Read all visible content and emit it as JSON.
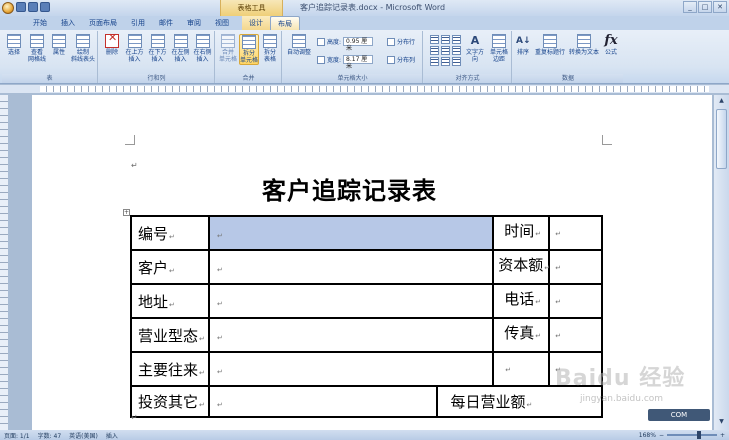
{
  "window": {
    "title": "客户追踪记录表.docx - Microsoft Word",
    "context_tools": "表格工具",
    "controls": [
      "_",
      "□",
      "✕"
    ]
  },
  "tabs": [
    {
      "label": "开始",
      "active": false
    },
    {
      "label": "插入",
      "active": false
    },
    {
      "label": "页面布局",
      "active": false
    },
    {
      "label": "引用",
      "active": false
    },
    {
      "label": "邮件",
      "active": false
    },
    {
      "label": "审阅",
      "active": false
    },
    {
      "label": "视图",
      "active": false
    },
    {
      "label": "设计",
      "active": false,
      "contextual": true
    },
    {
      "label": "布局",
      "active": true,
      "contextual": true
    }
  ],
  "ribbon": {
    "groups": {
      "table": "表",
      "rows_cols": "行和列",
      "merge": "合并",
      "cell_size": "单元格大小",
      "alignment": "对齐方式",
      "data": "数据"
    },
    "buttons": {
      "select": "选择",
      "view_gridlines": "查看\n网格线",
      "properties": "属性",
      "draw_diagonal": "绘制\n斜线表头",
      "delete": "删除",
      "insert_above": "在上方\n插入",
      "insert_below": "在下方\n插入",
      "insert_left": "在左侧\n插入",
      "insert_right": "在右侧\n插入",
      "merge_cells": "合并\n单元格",
      "split_cells": "拆分\n单元格",
      "split_table": "拆分\n表格",
      "autofit": "自动调整",
      "height_label": "高度:",
      "height_value": "0.95 厘米",
      "width_label": "宽度:",
      "width_value": "8.17 厘米",
      "distribute_rows": "分布行",
      "distribute_cols": "分布列",
      "text_direction": "文字方向",
      "cell_margins": "单元格\n边距",
      "sort": "排序",
      "repeat_header": "重复标题行",
      "convert_to_text": "转换为文本",
      "formula": "公式"
    }
  },
  "document": {
    "title": "客户追踪记录表",
    "rows": [
      [
        "编号",
        "",
        "时间",
        ""
      ],
      [
        "客户",
        "",
        "资本额",
        ""
      ],
      [
        "地址",
        "",
        "电话",
        ""
      ],
      [
        "营业型态",
        "",
        "传真",
        ""
      ],
      [
        "主要往来",
        "",
        "",
        ""
      ],
      [
        "投资其它",
        "",
        "每日营业额",
        ""
      ]
    ]
  },
  "statusbar": {
    "page": "页面: 1/1",
    "words": "字数: 47",
    "language": "英语(美国)",
    "mode": "插入",
    "zoom": "168%"
  },
  "watermark": {
    "text": "Baidu 经验",
    "sub": "jingyan.baidu.com",
    "badge": "COM"
  }
}
